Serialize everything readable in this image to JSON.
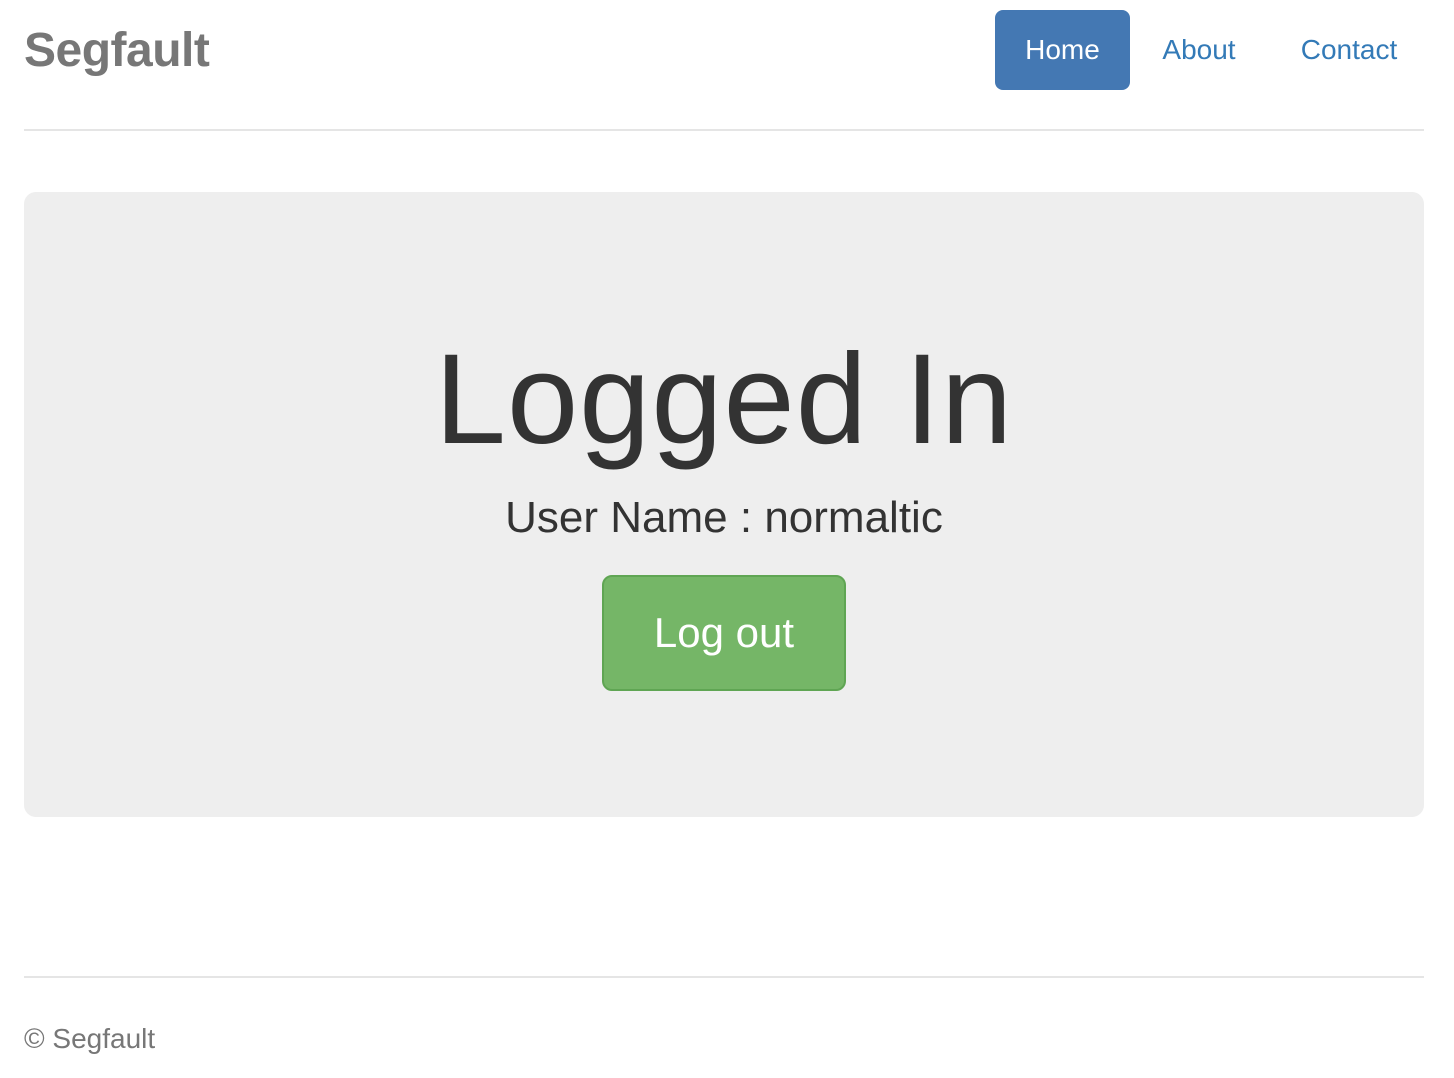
{
  "header": {
    "brand": "Segfault",
    "nav": [
      {
        "label": "Home",
        "active": true
      },
      {
        "label": "About",
        "active": false
      },
      {
        "label": "Contact",
        "active": false
      }
    ]
  },
  "main": {
    "heading": "Logged In",
    "user_label": "User Name : normaltic",
    "logout_label": "Log out"
  },
  "footer": {
    "copyright": "© Segfault"
  },
  "colors": {
    "nav_active_bg": "#4478b3",
    "link": "#337ab7",
    "jumbotron_bg": "#eeeeee",
    "logout_bg": "#75b667"
  }
}
